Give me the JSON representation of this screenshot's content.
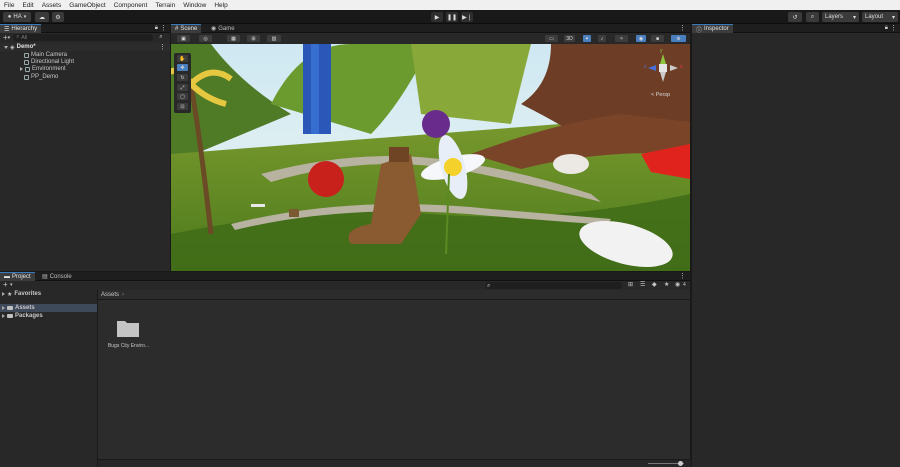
{
  "menu": [
    "File",
    "Edit",
    "Assets",
    "GameObject",
    "Component",
    "Terrain",
    "Window",
    "Help"
  ],
  "toolbar": {
    "account": "HA",
    "layers": "Layers",
    "layout": "Layout"
  },
  "hierarchy": {
    "tab": "Hierarchy",
    "search_placeholder": "All",
    "scene": "Demo*",
    "items": [
      "Main Camera",
      "Directional Light",
      "Environment",
      "PP_Demo"
    ]
  },
  "scene_tabs": {
    "scene": "Scene",
    "game": "Game"
  },
  "scene_toolbar": {
    "mode_2d": "3D",
    "persp_label": "< Persp"
  },
  "gizmo": {
    "y": "y",
    "x": "x",
    "z": "z"
  },
  "inspector": {
    "tab": "Inspector"
  },
  "bottom_tabs": {
    "project": "Project",
    "console": "Console"
  },
  "project": {
    "favorites": "Favorites",
    "tree": [
      "Assets",
      "Packages"
    ],
    "breadcrumb": "Assets",
    "badge_count": "4",
    "assets": [
      {
        "name": "Bugs City Enviro..."
      }
    ]
  },
  "colors": {
    "accent": "#3a79bb",
    "panel": "#282828",
    "dark": "#191919"
  }
}
